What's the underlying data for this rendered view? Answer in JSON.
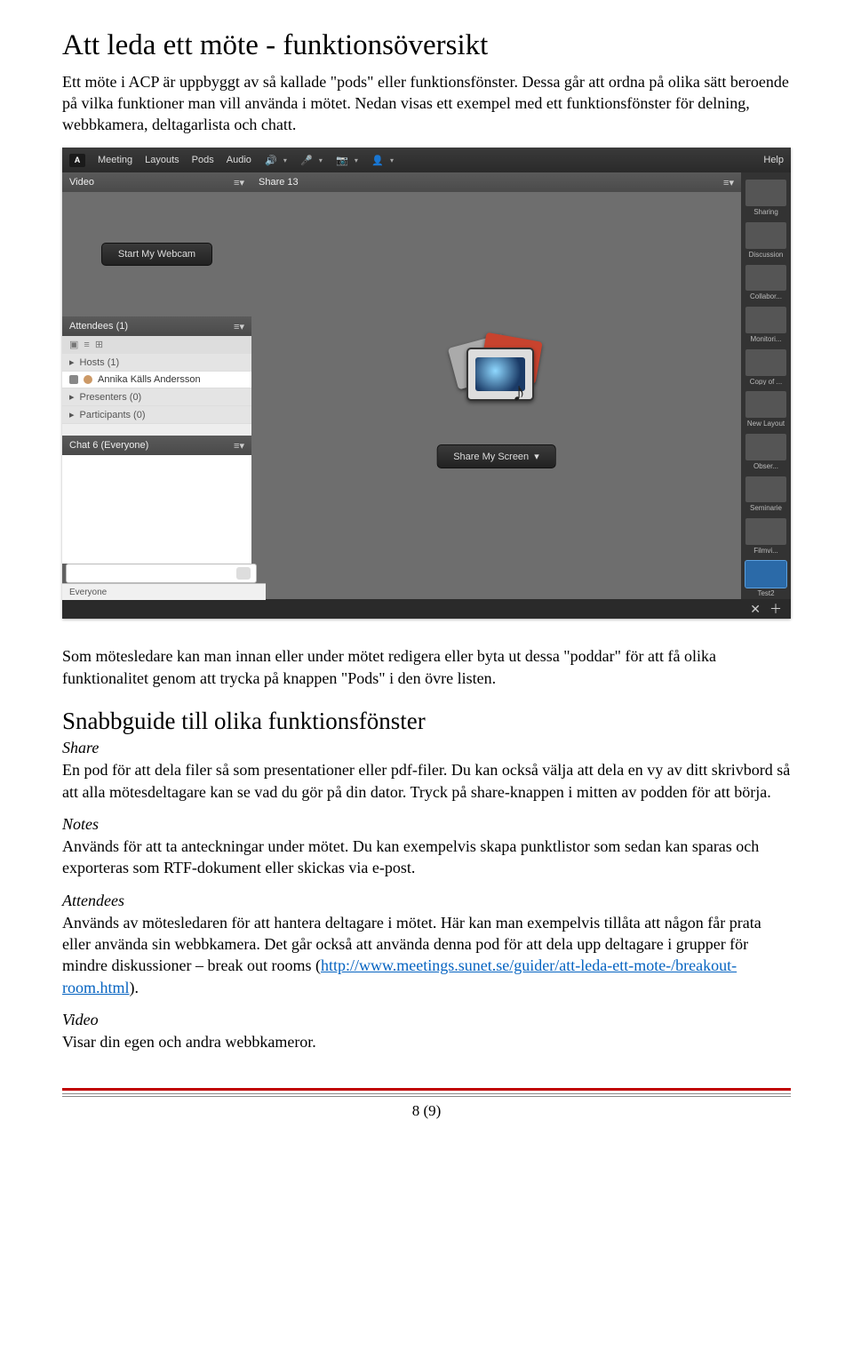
{
  "h1": "Att leda ett möte - funktionsöversikt",
  "intro": "Ett möte i ACP är uppbyggt av så kallade \"pods\" eller funktionsfönster. Dessa går att ordna på olika sätt beroende på vilka funktioner man vill använda i mötet. Nedan visas ett exempel med ett funktionsfönster för delning, webbkamera, deltagarlista och chatt.",
  "screenshot": {
    "menu": {
      "meeting": "Meeting",
      "layouts": "Layouts",
      "pods": "Pods",
      "audio": "Audio",
      "help": "Help"
    },
    "pods": {
      "video": {
        "title": "Video",
        "btn": "Start My Webcam"
      },
      "share": {
        "title": "Share 13",
        "btn": "Share My Screen"
      },
      "attendees": {
        "title": "Attendees (1)",
        "hosts": "Hosts (1)",
        "hostName": "Annika Källs Andersson",
        "presenters": "Presenters (0)",
        "participants": "Participants (0)"
      },
      "chat": {
        "title": "Chat 6 (Everyone)",
        "tab": "Everyone"
      }
    },
    "layouts": [
      "Sharing",
      "Discussion",
      "Collabor...",
      "Monitori...",
      "Copy of ...",
      "New Layout",
      "Obser...",
      "Seminarie",
      "Filmvi...",
      "Test2"
    ]
  },
  "para2": "Som mötesledare kan man innan eller under mötet redigera eller byta ut dessa \"poddar\" för att få olika funktionalitet genom att trycka på knappen \"Pods\" i den övre listen.",
  "h2": "Snabbguide till olika funktionsfönster",
  "sections": {
    "share": {
      "title": "Share",
      "body": "En pod för att dela filer så som presentationer eller pdf-filer. Du kan också välja att dela en vy av ditt skrivbord så att alla mötesdeltagare kan se vad du gör på din dator. Tryck på share-knappen i mitten av podden för att börja."
    },
    "notes": {
      "title": "Notes",
      "body": "Används för att ta anteckningar under mötet. Du kan exempelvis skapa punktlistor som sedan kan sparas och exporteras som RTF-dokument eller skickas via e-post."
    },
    "attendees": {
      "title": "Attendees",
      "body_before": "Används av mötesledaren för att hantera deltagare i mötet. Här kan man exempelvis tillåta att någon får prata eller använda sin webbkamera. Det går också att använda denna pod för att dela upp deltagare i grupper för mindre diskussioner – break out rooms (",
      "link": "http://www.meetings.sunet.se/guider/att-leda-ett-mote-/breakout-room.html",
      "body_after": ")."
    },
    "video": {
      "title": "Video",
      "body": "Visar din egen och andra webbkameror."
    }
  },
  "pagenum": "8 (9)"
}
